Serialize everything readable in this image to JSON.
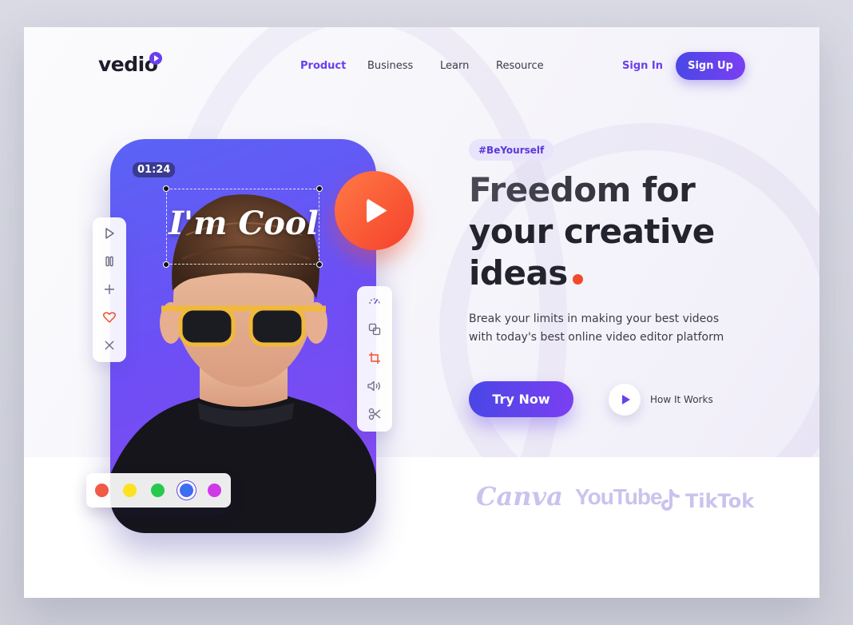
{
  "brand": {
    "name": "vedio"
  },
  "nav": {
    "items": [
      "Product",
      "Business",
      "Learn",
      "Resource"
    ],
    "active": "Product",
    "sign_in": "Sign In",
    "sign_up": "Sign Up"
  },
  "editor": {
    "timestamp": "01:24",
    "caption": "I'm Cool",
    "left_tools": [
      "play-icon",
      "pause-icon",
      "plus-icon",
      "heart-icon",
      "close-icon"
    ],
    "right_tools": [
      "speed-icon",
      "layers-icon",
      "crop-icon",
      "volume-icon",
      "scissors-icon"
    ],
    "palette": [
      "#f15a47",
      "#fde21f",
      "#28c94d",
      "#3d6df0",
      "#cf39e6"
    ],
    "selected_color": "#3d6df0"
  },
  "hero": {
    "tag": "#BeYourself",
    "headline_1": "Freedom for",
    "headline_2": "your creative",
    "headline_3": "ideas",
    "sub_1": "Break your limits in making your best videos",
    "sub_2": "with today's best online video editor platform",
    "try_now": "Try Now",
    "how_it_works": "How It Works"
  },
  "partners": [
    "Canva",
    "YouTube",
    "TikTok"
  ],
  "colors": {
    "accent": "#6a3ef0",
    "play_orange": "#f5502c",
    "dot": "#f04a2c"
  }
}
